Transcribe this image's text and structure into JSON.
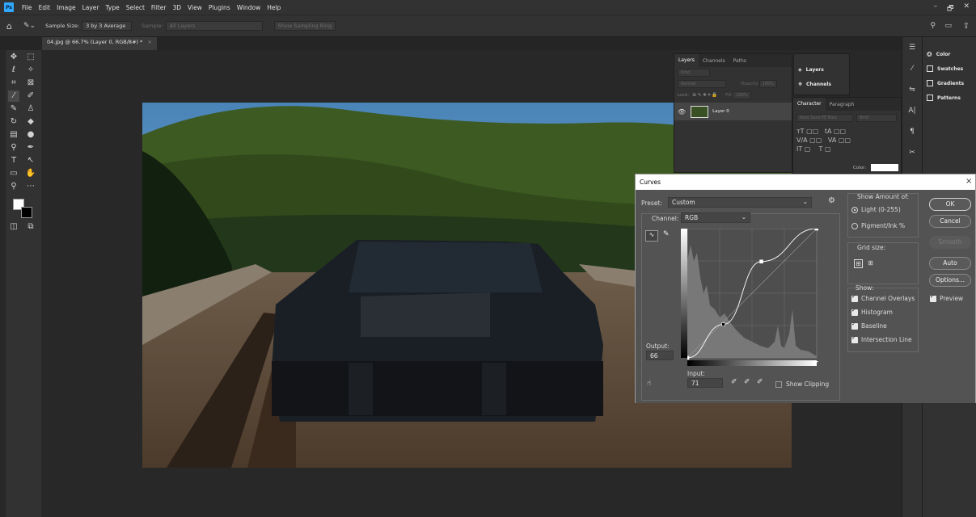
{
  "app": {
    "logo": "Ps",
    "menu": [
      "File",
      "Edit",
      "Image",
      "Layer",
      "Type",
      "Select",
      "Filter",
      "3D",
      "View",
      "Plugins",
      "Window",
      "Help"
    ],
    "window_controls": [
      "–",
      "🗗",
      "✕"
    ]
  },
  "options_bar": {
    "sample_size_label": "Sample Size:",
    "sample_size_value": "3 by 3 Average",
    "sample_label": "Sample:",
    "sample_value": "All Layers",
    "show_sampling_ring": "Show Sampling Ring"
  },
  "document_tab": {
    "title": "04.jpg @ 66.7% (Layer 0, RGB/8#) *",
    "close": "×"
  },
  "right_panel": {
    "items": [
      "Color",
      "Swatches",
      "Gradients",
      "Patterns"
    ]
  },
  "layers_panel": {
    "tabs": [
      "Layers",
      "Channels",
      "Paths"
    ],
    "kind": "Kind",
    "blend_mode": "Normal",
    "opacity_label": "Opacity:",
    "opacity_value": "100%",
    "lock_label": "Lock:",
    "fill_label": "Fill:",
    "fill_value": "100%",
    "layer_name": "Layer 0"
  },
  "mini_panel": {
    "items": [
      "Layers",
      "Channels"
    ]
  },
  "character_panel": {
    "tabs": [
      "Character",
      "Paragraph"
    ],
    "font": "Noto Sans PE Bolo",
    "style": "Bold",
    "color_label": "Color:"
  },
  "curves": {
    "title": "Curves",
    "preset_label": "Preset:",
    "preset_value": "Custom",
    "channel_label": "Channel:",
    "channel_value": "RGB",
    "output_label": "Output:",
    "output_value": "66",
    "input_label": "Input:",
    "input_value": "71",
    "show_clipping": "Show Clipping",
    "show_amount_label": "Show Amount of:",
    "light_option": "Light  (0-255)",
    "pigment_option": "Pigment/Ink %",
    "grid_size_label": "Grid size:",
    "show_label": "Show:",
    "show_options": [
      "Channel Overlays",
      "Histogram",
      "Baseline",
      "Intersection Line"
    ],
    "buttons": {
      "ok": "OK",
      "cancel": "Cancel",
      "smooth": "Smooth",
      "auto": "Auto",
      "options": "Options..."
    },
    "preview": "Preview",
    "curve_points": [
      [
        0,
        0
      ],
      [
        71,
        66
      ],
      [
        146,
        190
      ],
      [
        255,
        255
      ]
    ]
  }
}
